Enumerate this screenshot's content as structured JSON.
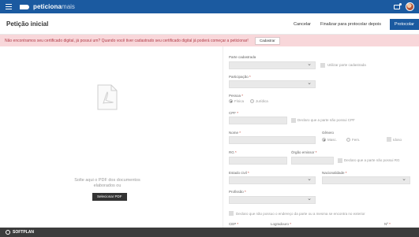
{
  "brand": {
    "name": "peticiona",
    "suffix": "mais"
  },
  "header": {
    "title": "Petição inicial",
    "cancel_label": "Cancelar",
    "finish_later_label": "Finalizar para protocolar depois",
    "protocol_label": "Protocolar"
  },
  "alert": {
    "message": "Não encontramos seu certificado digital, já possui um? Quando você tiver cadastrado seu certificado digital já poderá começar a peticionar!",
    "button_label": "Cadastrar"
  },
  "upload": {
    "drop_text": "Solte aqui o PDF dos documentos elaborados ou",
    "button_label": "Selecionar PDF"
  },
  "form": {
    "parte_cadastrada": {
      "label": "Parte cadastrada",
      "checkbox_label": "Utilizar parte cadastrada"
    },
    "participacao": {
      "label": "Participação"
    },
    "pessoa": {
      "label": "Pessoa",
      "options": [
        "Física",
        "Jurídica"
      ],
      "selected": "Física"
    },
    "cpf": {
      "label": "CPF",
      "checkbox_label": "Declaro que a parte não possui CPF"
    },
    "nome": {
      "label": "Nome"
    },
    "genero": {
      "label": "Gênero",
      "options": [
        "Masc.",
        "Fem."
      ],
      "selected": "Masc.",
      "idoso_label": "Idoso"
    },
    "rg": {
      "label": "RG",
      "orgao_label": "Órgão emissor",
      "checkbox_label": "Declaro que a parte não possui RG"
    },
    "estado_civil": {
      "label": "Estado civil"
    },
    "nacionalidade": {
      "label": "Nacionalidade"
    },
    "profissao": {
      "label": "Profissão"
    },
    "endereco": {
      "checkbox_label": "Declaro que não possuo o endereço da parte ou a mesma se encontra no exterior"
    },
    "cep": {
      "label": "CEP"
    },
    "logradouro": {
      "label": "Logradouro"
    },
    "numero": {
      "label": "Nº"
    }
  },
  "footer": {
    "text": "SOFTPLAN"
  },
  "icons": {
    "menu": "hamburger-icon",
    "notifications": "notification-icon",
    "pdf": "pdf-file-icon",
    "logo": "softplan-logo-icon"
  },
  "colors": {
    "primary": "#1b5aa0",
    "alert_bg": "#f8d7da",
    "alert_text": "#b13a46",
    "footer": "#3c3c3c"
  }
}
